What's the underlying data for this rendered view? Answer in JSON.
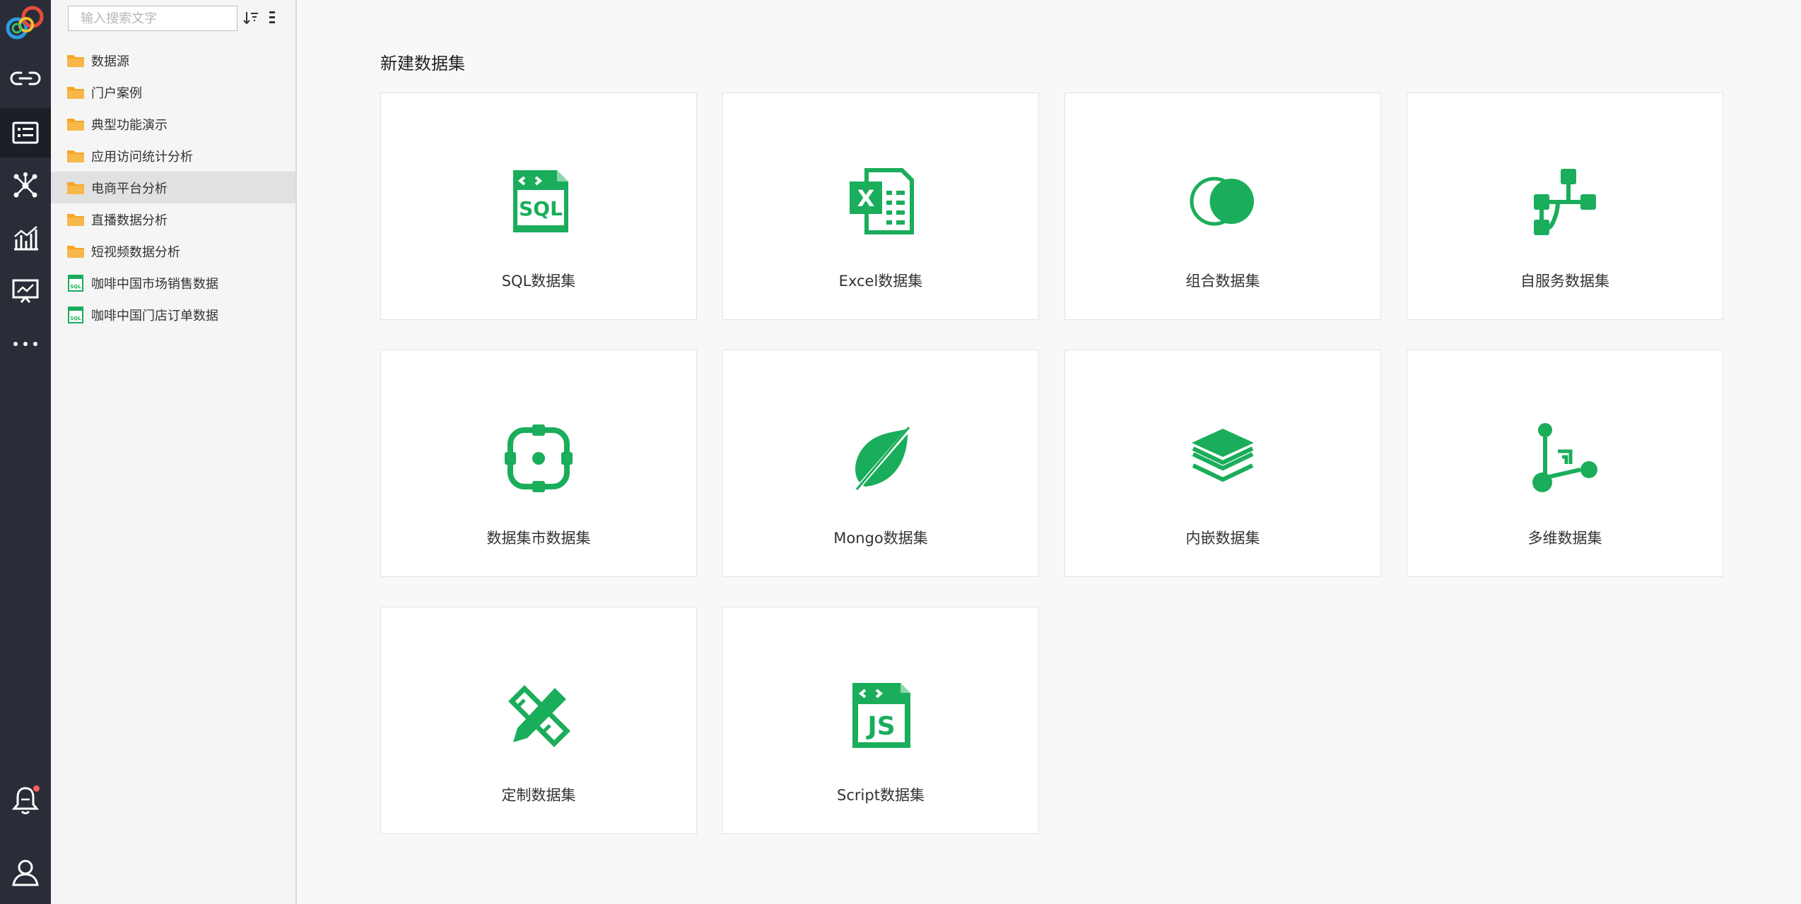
{
  "rail": {
    "items": [
      {
        "id": "connect",
        "icon": "link-icon"
      },
      {
        "id": "dataset",
        "icon": "dataset-list-icon"
      },
      {
        "id": "model",
        "icon": "network-icon"
      },
      {
        "id": "analysis",
        "icon": "chart-icon"
      },
      {
        "id": "dashboard",
        "icon": "presentation-icon"
      },
      {
        "id": "more",
        "icon": "more-dots-icon"
      },
      {
        "id": "notify",
        "icon": "bell-icon"
      },
      {
        "id": "user",
        "icon": "user-icon"
      }
    ],
    "active": "dataset",
    "notification_dot_color": "#ff5b5b"
  },
  "tree": {
    "search_placeholder": "输入搜索文字",
    "items": [
      {
        "label": "数据源",
        "type": "folder"
      },
      {
        "label": "门户案例",
        "type": "folder"
      },
      {
        "label": "典型功能演示",
        "type": "folder"
      },
      {
        "label": "应用访问统计分析",
        "type": "folder"
      },
      {
        "label": "电商平台分析",
        "type": "folder",
        "selected": true
      },
      {
        "label": "直播数据分析",
        "type": "folder"
      },
      {
        "label": "短视频数据分析",
        "type": "folder"
      },
      {
        "label": "咖啡中国市场销售数据",
        "type": "sql"
      },
      {
        "label": "咖啡中国门店订单数据",
        "type": "sql"
      }
    ]
  },
  "main": {
    "title": "新建数据集",
    "accent": "#1aad5b",
    "cards": [
      {
        "label": "SQL数据集",
        "icon": "sql-file-icon"
      },
      {
        "label": "Excel数据集",
        "icon": "excel-file-icon"
      },
      {
        "label": "组合数据集",
        "icon": "combine-circles-icon"
      },
      {
        "label": "自服务数据集",
        "icon": "flow-tree-icon"
      },
      {
        "label": "数据集市数据集",
        "icon": "target-node-icon"
      },
      {
        "label": "Mongo数据集",
        "icon": "leaf-icon"
      },
      {
        "label": "内嵌数据集",
        "icon": "layers-icon"
      },
      {
        "label": "多维数据集",
        "icon": "cube-nodes-icon"
      },
      {
        "label": "定制数据集",
        "icon": "pencil-ruler-icon"
      },
      {
        "label": "Script数据集",
        "icon": "js-file-icon"
      }
    ]
  },
  "colors": {
    "folder": "#f5a623",
    "rail_bg": "#2a2d37",
    "tree_bg": "#f5f5f5"
  }
}
